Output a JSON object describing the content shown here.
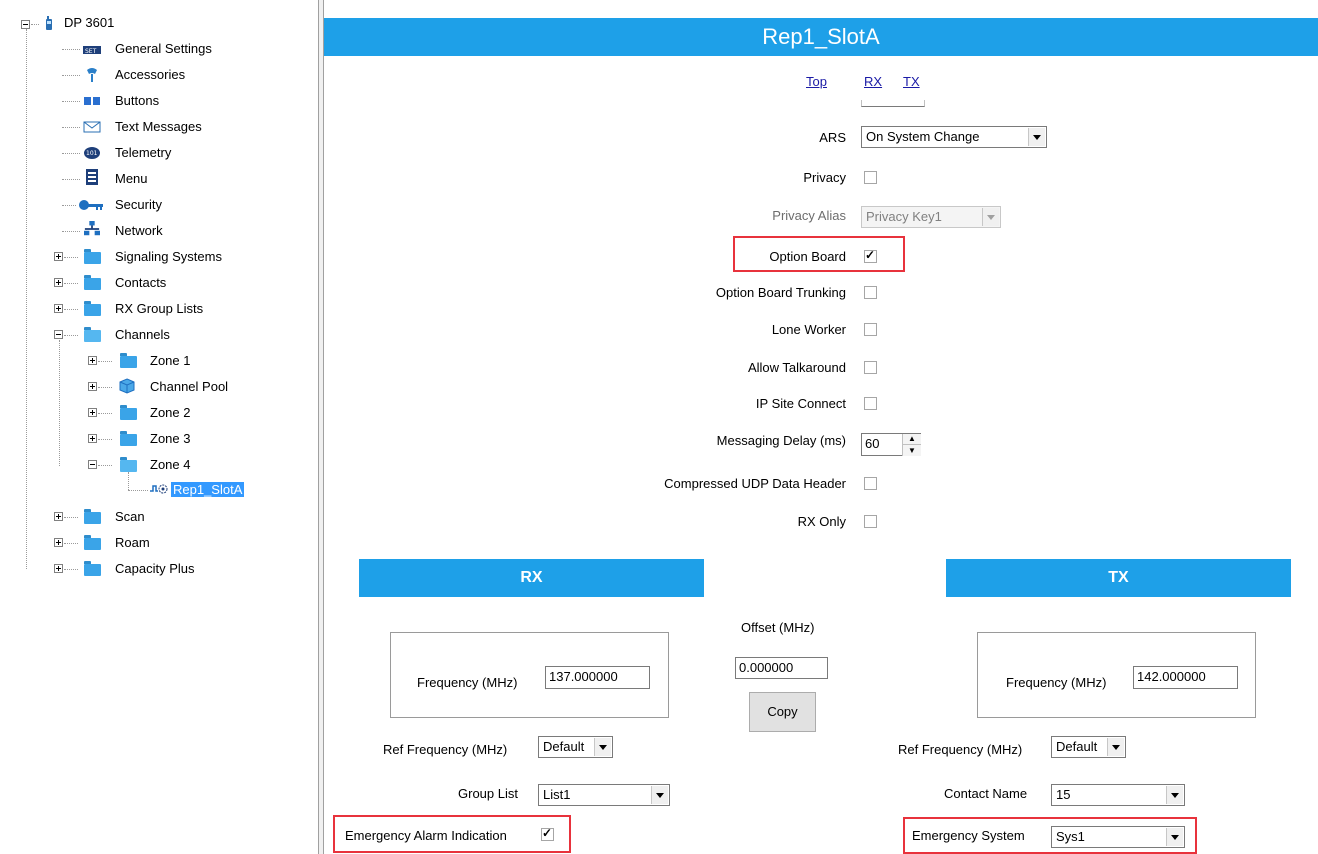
{
  "tree": {
    "root": "DP 3601",
    "items": [
      {
        "label": "General Settings",
        "icon": "settings-icon"
      },
      {
        "label": "Accessories",
        "icon": "accessories-icon"
      },
      {
        "label": "Buttons",
        "icon": "buttons-icon"
      },
      {
        "label": "Text Messages",
        "icon": "envelope-icon"
      },
      {
        "label": "Telemetry",
        "icon": "telemetry-icon"
      },
      {
        "label": "Menu",
        "icon": "menu-icon"
      },
      {
        "label": "Security",
        "icon": "key-icon"
      },
      {
        "label": "Network",
        "icon": "network-icon"
      },
      {
        "label": "Signaling Systems",
        "icon": "folder-icon"
      },
      {
        "label": "Contacts",
        "icon": "folder-icon"
      },
      {
        "label": "RX Group Lists",
        "icon": "folder-icon"
      },
      {
        "label": "Channels",
        "icon": "folder-open-icon"
      },
      {
        "label": "Zone 1",
        "icon": "folder-icon"
      },
      {
        "label": "Channel Pool",
        "icon": "cube-icon"
      },
      {
        "label": "Zone 2",
        "icon": "folder-icon"
      },
      {
        "label": "Zone 3",
        "icon": "folder-icon"
      },
      {
        "label": "Zone 4",
        "icon": "folder-open-icon"
      },
      {
        "label": "Rep1_SlotA",
        "icon": "channel-icon"
      },
      {
        "label": "Scan",
        "icon": "folder-icon"
      },
      {
        "label": "Roam",
        "icon": "folder-icon"
      },
      {
        "label": "Capacity Plus",
        "icon": "folder-icon"
      }
    ]
  },
  "panel": {
    "title": "Rep1_SlotA",
    "nav": {
      "top": "Top",
      "rx": "RX",
      "tx": "TX"
    },
    "fields": {
      "ars_label": "ARS",
      "ars_value": "On System Change",
      "privacy_label": "Privacy",
      "privacy_alias_label": "Privacy Alias",
      "privacy_alias_value": "Privacy Key1",
      "option_board_label": "Option Board",
      "option_board_trunking_label": "Option Board Trunking",
      "lone_worker_label": "Lone Worker",
      "allow_talkaround_label": "Allow Talkaround",
      "ip_site_connect_label": "IP Site Connect",
      "messaging_delay_label": "Messaging Delay (ms)",
      "messaging_delay_value": "60",
      "compressed_udp_label": "Compressed UDP Data Header",
      "rx_only_label": "RX Only"
    },
    "checks": {
      "privacy": false,
      "option_board": true,
      "option_board_trunking": false,
      "lone_worker": false,
      "allow_talkaround": false,
      "ip_site_connect": false,
      "compressed_udp": false,
      "rx_only": false,
      "emergency_alarm_indication": true
    },
    "rx": {
      "header": "RX",
      "frequency_label": "Frequency (MHz)",
      "frequency_value": "137.000000",
      "ref_freq_label": "Ref Frequency (MHz)",
      "ref_freq_value": "Default",
      "group_list_label": "Group List",
      "group_list_value": "List1",
      "emergency_alarm_label": "Emergency Alarm Indication"
    },
    "offset": {
      "label": "Offset (MHz)",
      "value": "0.000000",
      "copy_label": "Copy"
    },
    "tx": {
      "header": "TX",
      "frequency_label": "Frequency (MHz)",
      "frequency_value": "142.000000",
      "ref_freq_label": "Ref Frequency (MHz)",
      "ref_freq_value": "Default",
      "contact_name_label": "Contact Name",
      "contact_name_value": "15",
      "emergency_system_label": "Emergency System",
      "emergency_system_value": "Sys1"
    },
    "colors": {
      "header_blue": "#1ea0e8",
      "highlight_red": "#e8323c",
      "selection_blue": "#3399ff"
    }
  }
}
